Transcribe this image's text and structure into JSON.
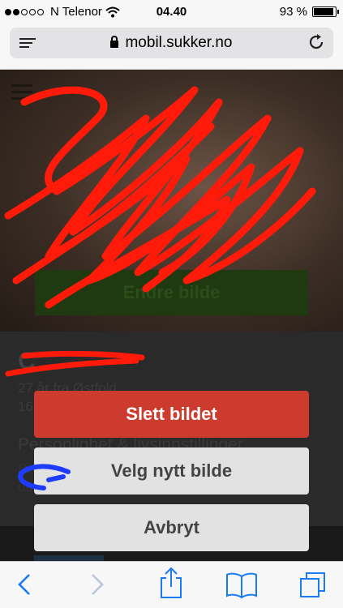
{
  "status_bar": {
    "carrier": "N Telenor",
    "time": "04.40",
    "battery": "93 %",
    "battery_level": 0.93
  },
  "browser": {
    "url": "mobil.sukker.no"
  },
  "page": {
    "change_photo_label": "Endre bilde",
    "profile_name": "C",
    "profile_info": "27 år fra Østfold",
    "profile_extra": "16",
    "section_title": "Personlighet & livsinnstillinger",
    "section_line1": "Du",
    "section_line2": "utt"
  },
  "action_sheet": {
    "delete_label": "Slett bildet",
    "choose_label": "Velg nytt bilde",
    "cancel_label": "Avbryt",
    "delete_color": "#cc3b2e"
  },
  "toolbar": {
    "icons": [
      "back-icon",
      "forward-icon",
      "share-icon",
      "bookmarks-icon",
      "tabs-icon"
    ],
    "accent": "#1a7cf5"
  }
}
